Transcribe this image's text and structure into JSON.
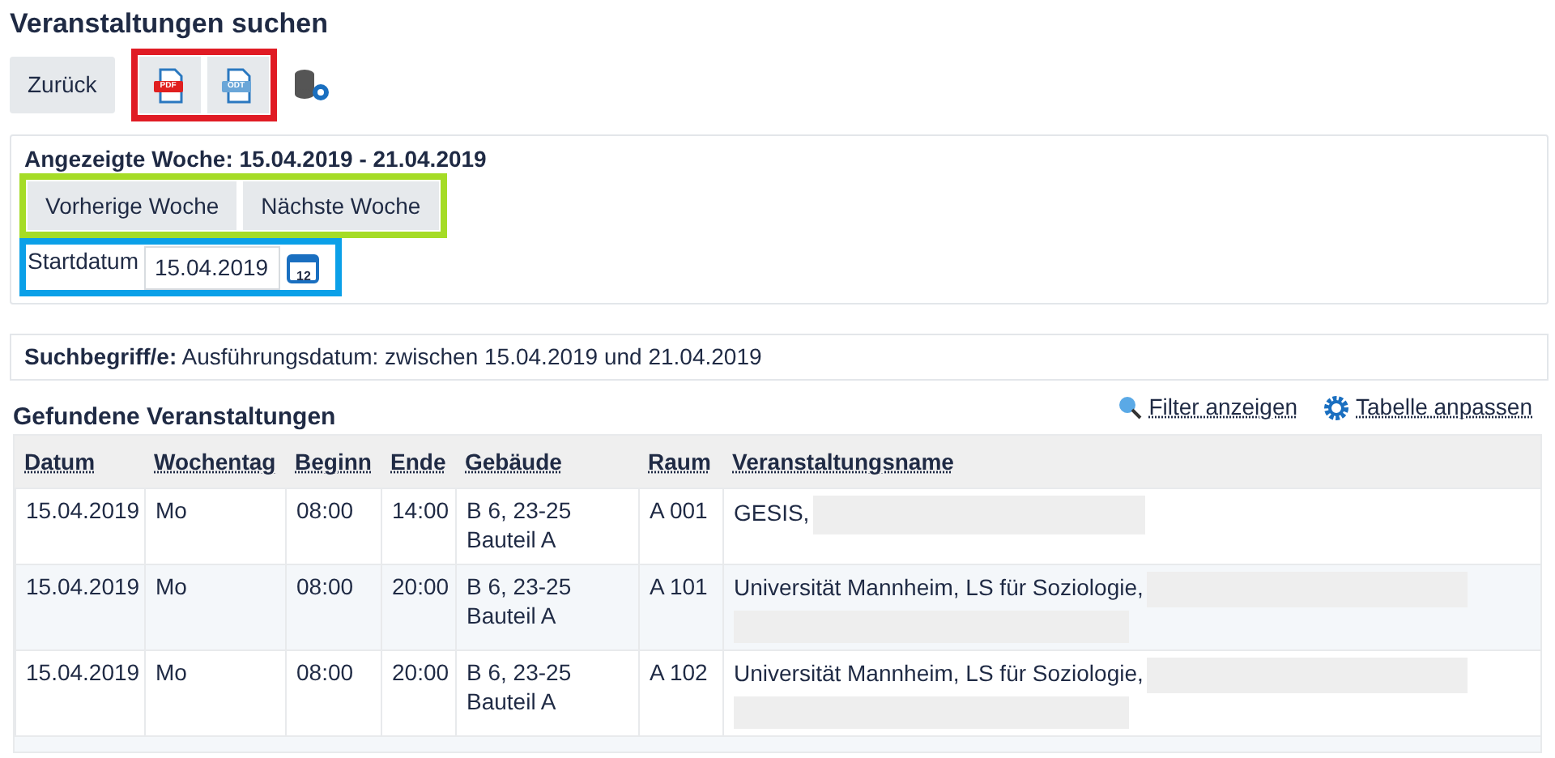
{
  "title": "Veranstaltungen suchen",
  "toolbar": {
    "back": "Zurück",
    "exports": [
      {
        "kind": "pdf",
        "label": "PDF"
      },
      {
        "kind": "odt",
        "label": "ODT"
      }
    ]
  },
  "week": {
    "label": "Angezeigte Woche: 15.04.2019 - 21.04.2019",
    "buttons": [
      "Vorherige Woche",
      "Nächste Woche"
    ],
    "start_label": "Startdatum",
    "start_value": "15.04.2019",
    "calendar_day": "12"
  },
  "search_terms": {
    "label": "Suchbegriff/e:",
    "value": "Ausführungsdatum: zwischen 15.04.2019 und 21.04.2019"
  },
  "results": {
    "title": "Gefundene Veranstaltungen",
    "links": [
      {
        "kind": "filter",
        "label": "Filter anzeigen"
      },
      {
        "kind": "settings",
        "label": "Tabelle anpassen"
      }
    ]
  },
  "table": {
    "columns": [
      "Datum",
      "Wochentag",
      "Beginn",
      "Ende",
      "Gebäude",
      "Raum",
      "Veranstaltungsname"
    ],
    "rows": [
      {
        "cells": [
          "15.04.2019",
          "Mo",
          "08:00",
          "14:00",
          "B 6, 23-25 Bauteil A",
          "A 001",
          "GESIS,"
        ],
        "redacted": true
      },
      {
        "cells": [
          "15.04.2019",
          "Mo",
          "08:00",
          "20:00",
          "B 6, 23-25 Bauteil A",
          "A 101",
          "Universität Mannheim, LS für Soziologie,"
        ],
        "redacted": true
      },
      {
        "cells": [
          "15.04.2019",
          "Mo",
          "08:00",
          "20:00",
          "B 6, 23-25 Bauteil A",
          "A 102",
          "Universität Mannheim, LS für Soziologie,"
        ],
        "redacted": true
      }
    ]
  }
}
